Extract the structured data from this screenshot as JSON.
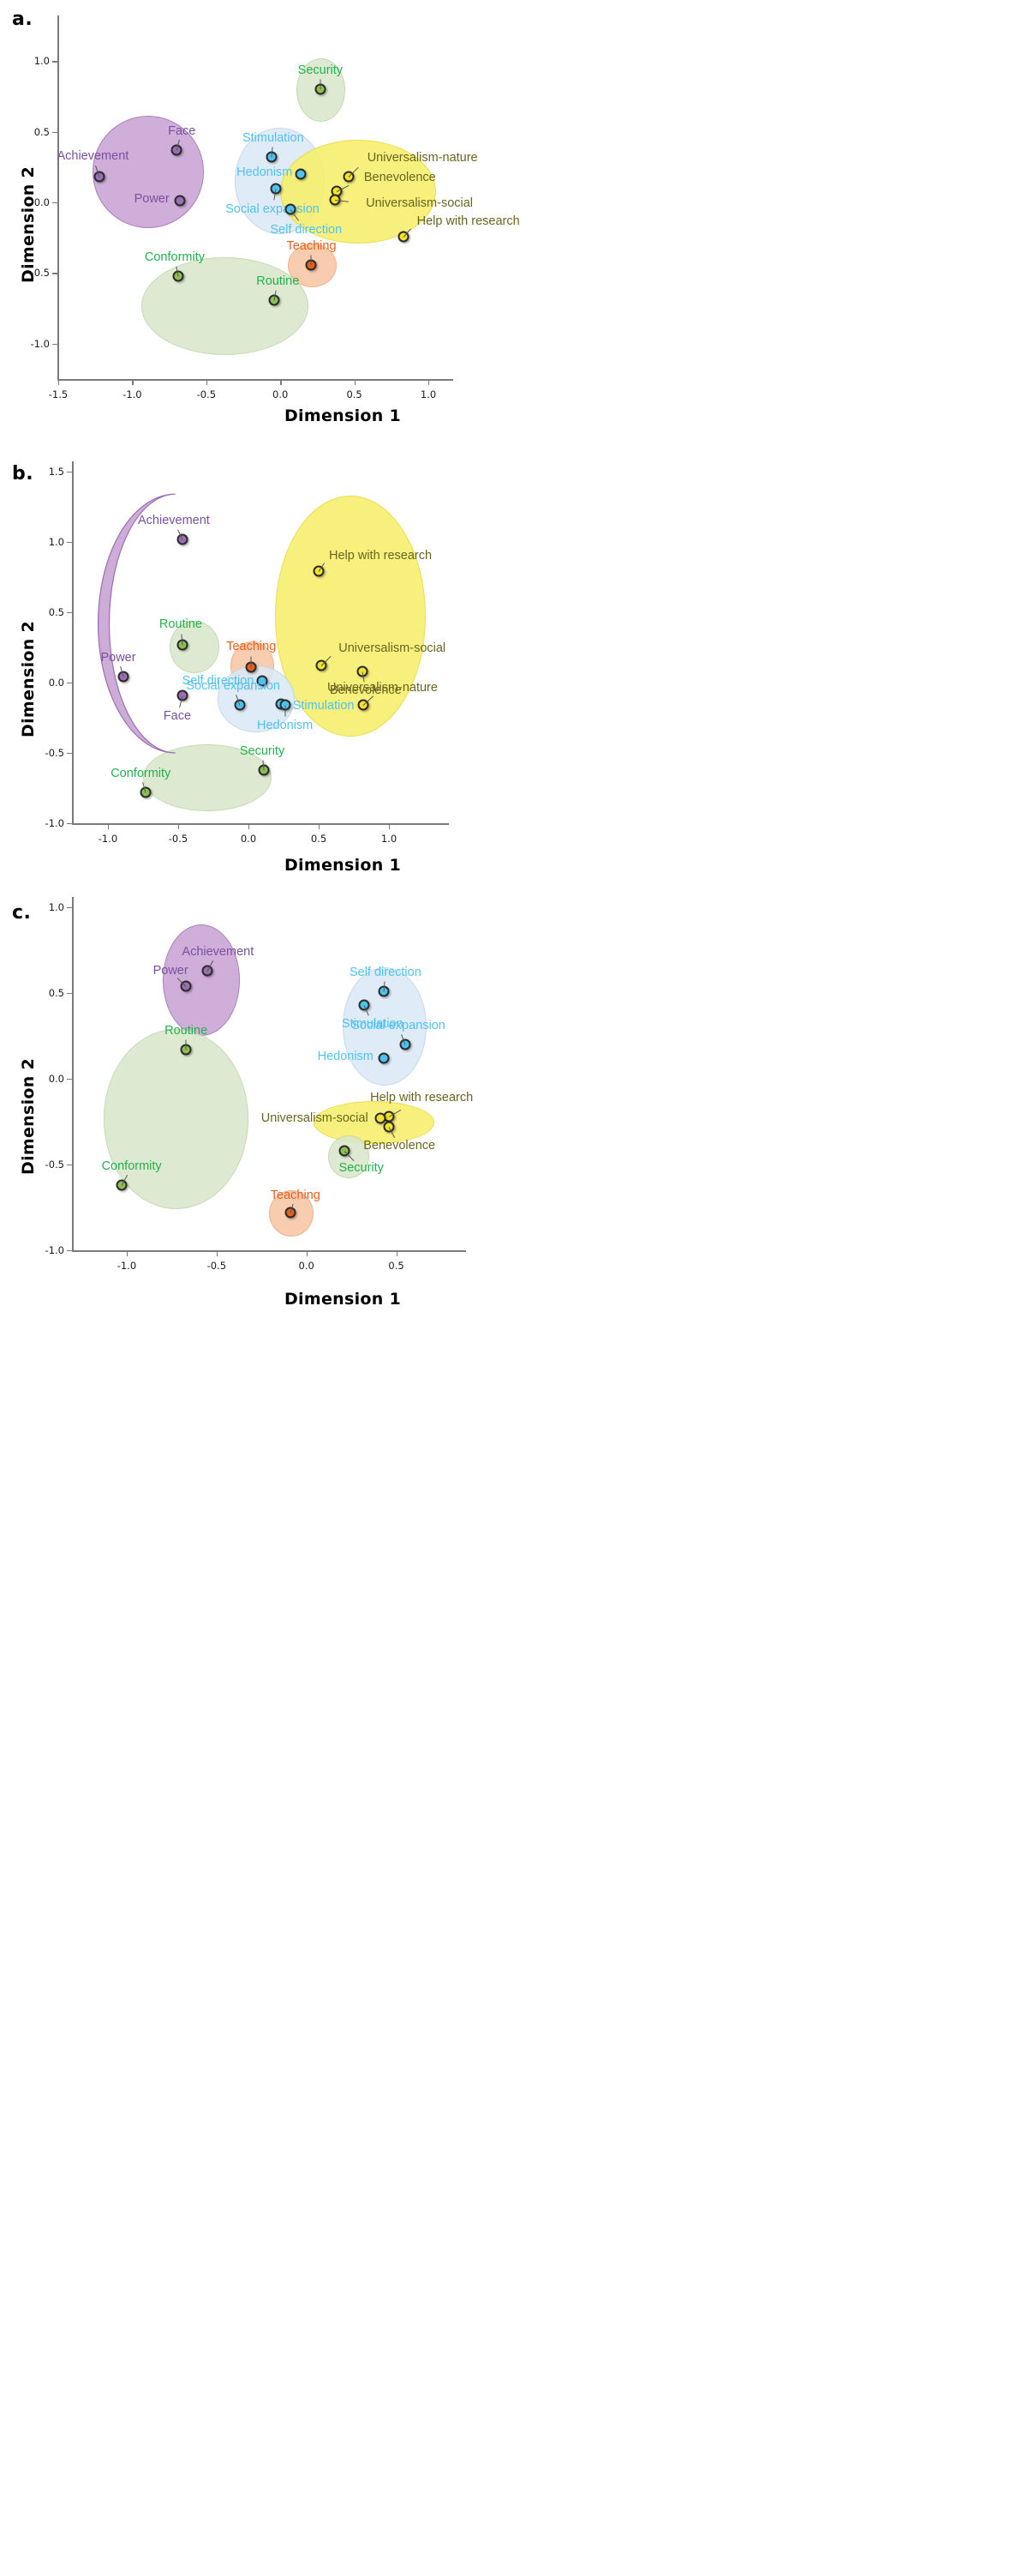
{
  "figure": {
    "panels": [
      "a.",
      "b.",
      "c."
    ],
    "axis_x_title": "Dimension 1",
    "axis_y_title": "Dimension 2"
  },
  "colors": {
    "purple_fill": "#c9a3d4",
    "purple_pt": "#9b6fb5",
    "purple_text": "#7b4f9e",
    "blue_fill": "#dbe9f5",
    "blue_pt": "#4fc3f0",
    "blue_text": "#4fc3f0",
    "yellow_fill": "#f7ef6a",
    "yellow_pt": "#f4e429",
    "yellow_text": "#6b6420",
    "green_fill": "#d9e8cb",
    "green_pt": "#8cc152",
    "green_text": "#22b14c",
    "orange_fill": "#f7c6a4",
    "orange_pt": "#e8601c",
    "orange_text": "#e8601c",
    "axis": "#7a7a7a"
  },
  "chart_data": [
    {
      "type": "scatter",
      "panel": "a.",
      "title": "",
      "xlabel": "Dimension 1",
      "ylabel": "Dimension 2",
      "xlim": [
        -1.5,
        1.0
      ],
      "ylim": [
        -1.25,
        1.25
      ],
      "xticks": [
        "-1.5",
        "-1.0",
        "-0.5",
        "0.0",
        "0.5",
        "1.0"
      ],
      "xtickvals": [
        -1.5,
        -1.0,
        -0.5,
        0.0,
        0.5,
        1.0
      ],
      "yticks": [
        "1.0",
        "0.5",
        "0.0",
        "-0.5",
        "-1.0"
      ],
      "ytickvals": [
        1.0,
        0.5,
        0.0,
        -0.5,
        -1.0
      ],
      "grid": false,
      "legend": "none",
      "points": [
        {
          "label": "Security",
          "x": 0.27,
          "y": 0.8,
          "group": "green"
        },
        {
          "label": "Face",
          "x": -0.7,
          "y": 0.37,
          "group": "purple"
        },
        {
          "label": "Achievement",
          "x": -1.22,
          "y": 0.18,
          "group": "purple"
        },
        {
          "label": "Power",
          "x": -0.68,
          "y": 0.01,
          "group": "purple"
        },
        {
          "label": "Stimulation",
          "x": -0.06,
          "y": 0.32,
          "group": "blue"
        },
        {
          "label": "Hedonism",
          "x": 0.14,
          "y": 0.2,
          "group": "blue"
        },
        {
          "label": "Social expansion",
          "x": -0.03,
          "y": 0.1,
          "group": "blue"
        },
        {
          "label": "Self direction",
          "x": 0.07,
          "y": -0.05,
          "group": "blue"
        },
        {
          "label": "Universalism-nature",
          "x": 0.46,
          "y": 0.18,
          "group": "yellow"
        },
        {
          "label": "Benevolence",
          "x": 0.38,
          "y": 0.08,
          "group": "yellow"
        },
        {
          "label": "Universalism-social",
          "x": 0.37,
          "y": 0.02,
          "group": "yellow"
        },
        {
          "label": "Help with research",
          "x": 0.83,
          "y": -0.24,
          "group": "yellow"
        },
        {
          "label": "Teaching",
          "x": 0.21,
          "y": -0.44,
          "group": "orange"
        },
        {
          "label": "Conformity",
          "x": -0.69,
          "y": -0.52,
          "group": "green"
        },
        {
          "label": "Routine",
          "x": -0.04,
          "y": -0.69,
          "group": "green"
        }
      ],
      "clusters": [
        {
          "group": "purple",
          "cx": -0.9,
          "cy": 0.22,
          "rx": 0.37,
          "ry": 0.39
        },
        {
          "group": "blue",
          "cx": -0.01,
          "cy": 0.16,
          "rx": 0.3,
          "ry": 0.37
        },
        {
          "group": "yellow",
          "cx": 0.52,
          "cy": 0.08,
          "rx": 0.52,
          "ry": 0.36
        },
        {
          "group": "green",
          "cx": 0.27,
          "cy": 0.8,
          "rx": 0.16,
          "ry": 0.22
        },
        {
          "group": "green",
          "cx": -0.38,
          "cy": -0.73,
          "rx": 0.56,
          "ry": 0.34
        },
        {
          "group": "orange",
          "cx": 0.21,
          "cy": -0.44,
          "rx": 0.16,
          "ry": 0.15
        }
      ]
    },
    {
      "type": "scatter",
      "panel": "b.",
      "title": "",
      "xlabel": "Dimension 1",
      "ylabel": "Dimension 2",
      "xlim": [
        -1.25,
        1.25
      ],
      "ylim": [
        -1.0,
        1.5
      ],
      "xticks": [
        "-1.0",
        "-0.5",
        "0.0",
        "0.5",
        "1.0"
      ],
      "xtickvals": [
        -1.0,
        -0.5,
        0.0,
        0.5,
        1.0
      ],
      "yticks": [
        "1.5",
        "1.0",
        "0.5",
        "0.0",
        "-0.5",
        "-1.0"
      ],
      "ytickvals": [
        1.5,
        1.0,
        0.5,
        0.0,
        -0.5,
        -1.0
      ],
      "grid": false,
      "legend": "none",
      "points": [
        {
          "label": "Achievement",
          "x": -0.47,
          "y": 1.02,
          "group": "purple"
        },
        {
          "label": "Help with research",
          "x": 0.5,
          "y": 0.79,
          "group": "yellow"
        },
        {
          "label": "Routine",
          "x": -0.47,
          "y": 0.27,
          "group": "green"
        },
        {
          "label": "Teaching",
          "x": 0.02,
          "y": 0.11,
          "group": "orange"
        },
        {
          "label": "Universalism-social",
          "x": 0.52,
          "y": 0.12,
          "group": "yellow"
        },
        {
          "label": "Benevolence",
          "x": 0.81,
          "y": 0.08,
          "group": "yellow"
        },
        {
          "label": "Power",
          "x": -0.89,
          "y": 0.04,
          "group": "purple"
        },
        {
          "label": "Self direction",
          "x": 0.1,
          "y": 0.01,
          "group": "blue"
        },
        {
          "label": "Face",
          "x": -0.47,
          "y": -0.09,
          "group": "purple"
        },
        {
          "label": "Universalism-nature",
          "x": 0.82,
          "y": -0.16,
          "group": "yellow"
        },
        {
          "label": "Social expansion",
          "x": -0.06,
          "y": -0.16,
          "group": "blue"
        },
        {
          "label": "Stimulation",
          "x": 0.23,
          "y": -0.15,
          "group": "blue"
        },
        {
          "label": "Hedonism",
          "x": 0.26,
          "y": -0.16,
          "group": "blue"
        },
        {
          "label": "Security",
          "x": 0.11,
          "y": -0.62,
          "group": "green"
        },
        {
          "label": "Conformity",
          "x": -0.73,
          "y": -0.78,
          "group": "green"
        }
      ],
      "clusters": [
        {
          "group": "yellow",
          "cx": 0.72,
          "cy": 0.48,
          "rx": 0.53,
          "ry": 0.85
        },
        {
          "group": "green",
          "cx": -0.39,
          "cy": 0.26,
          "rx": 0.17,
          "ry": 0.18
        },
        {
          "group": "orange",
          "cx": 0.02,
          "cy": 0.12,
          "rx": 0.15,
          "ry": 0.17
        },
        {
          "group": "blue",
          "cx": 0.05,
          "cy": -0.11,
          "rx": 0.27,
          "ry": 0.23
        },
        {
          "group": "green",
          "cx": -0.3,
          "cy": -0.67,
          "rx": 0.45,
          "ry": 0.23
        }
      ],
      "crescent": {
        "group": "purple",
        "note": "crescent-shaped purple region on the left"
      }
    },
    {
      "type": "scatter",
      "panel": "c.",
      "title": "",
      "xlabel": "Dimension 1",
      "ylabel": "Dimension 2",
      "xlim": [
        -1.3,
        0.75
      ],
      "ylim": [
        -1.0,
        1.0
      ],
      "xticks": [
        "-1.0",
        "-0.5",
        "0.0",
        "0.5"
      ],
      "xtickvals": [
        -1.0,
        -0.5,
        0.0,
        0.5
      ],
      "yticks": [
        "1.0",
        "0.5",
        "0.0",
        "-0.5",
        "-1.0"
      ],
      "ytickvals": [
        1.0,
        0.5,
        0.0,
        -0.5,
        -1.0
      ],
      "grid": false,
      "legend": "none",
      "points": [
        {
          "label": "Achievement",
          "x": -0.55,
          "y": 0.63,
          "group": "purple"
        },
        {
          "label": "Power",
          "x": -0.67,
          "y": 0.54,
          "group": "purple"
        },
        {
          "label": "Self direction",
          "x": 0.43,
          "y": 0.51,
          "group": "blue"
        },
        {
          "label": "Stimulation",
          "x": 0.32,
          "y": 0.43,
          "group": "blue"
        },
        {
          "label": "Social expansion",
          "x": 0.55,
          "y": 0.2,
          "group": "blue"
        },
        {
          "label": "Routine",
          "x": -0.67,
          "y": 0.17,
          "group": "green"
        },
        {
          "label": "Hedonism",
          "x": 0.43,
          "y": 0.12,
          "group": "blue"
        },
        {
          "label": "Help with research",
          "x": 0.46,
          "y": -0.22,
          "group": "yellow"
        },
        {
          "label": "Universalism-social",
          "x": 0.41,
          "y": -0.23,
          "group": "yellow"
        },
        {
          "label": "Benevolence",
          "x": 0.46,
          "y": -0.28,
          "group": "yellow"
        },
        {
          "label": "Security",
          "x": 0.21,
          "y": -0.42,
          "group": "green"
        },
        {
          "label": "Conformity",
          "x": -1.03,
          "y": -0.62,
          "group": "green"
        },
        {
          "label": "Teaching",
          "x": -0.09,
          "y": -0.78,
          "group": "orange"
        }
      ],
      "clusters": [
        {
          "group": "purple",
          "cx": -0.59,
          "cy": 0.58,
          "rx": 0.21,
          "ry": 0.32
        },
        {
          "group": "blue",
          "cx": 0.43,
          "cy": 0.31,
          "rx": 0.23,
          "ry": 0.34
        },
        {
          "group": "green",
          "cx": -0.73,
          "cy": -0.23,
          "rx": 0.4,
          "ry": 0.52
        },
        {
          "group": "yellow",
          "cx": 0.37,
          "cy": -0.25,
          "rx": 0.33,
          "ry": 0.12
        },
        {
          "group": "green",
          "cx": 0.23,
          "cy": -0.45,
          "rx": 0.11,
          "ry": 0.12
        },
        {
          "group": "orange",
          "cx": -0.09,
          "cy": -0.78,
          "rx": 0.12,
          "ry": 0.13
        }
      ]
    }
  ]
}
